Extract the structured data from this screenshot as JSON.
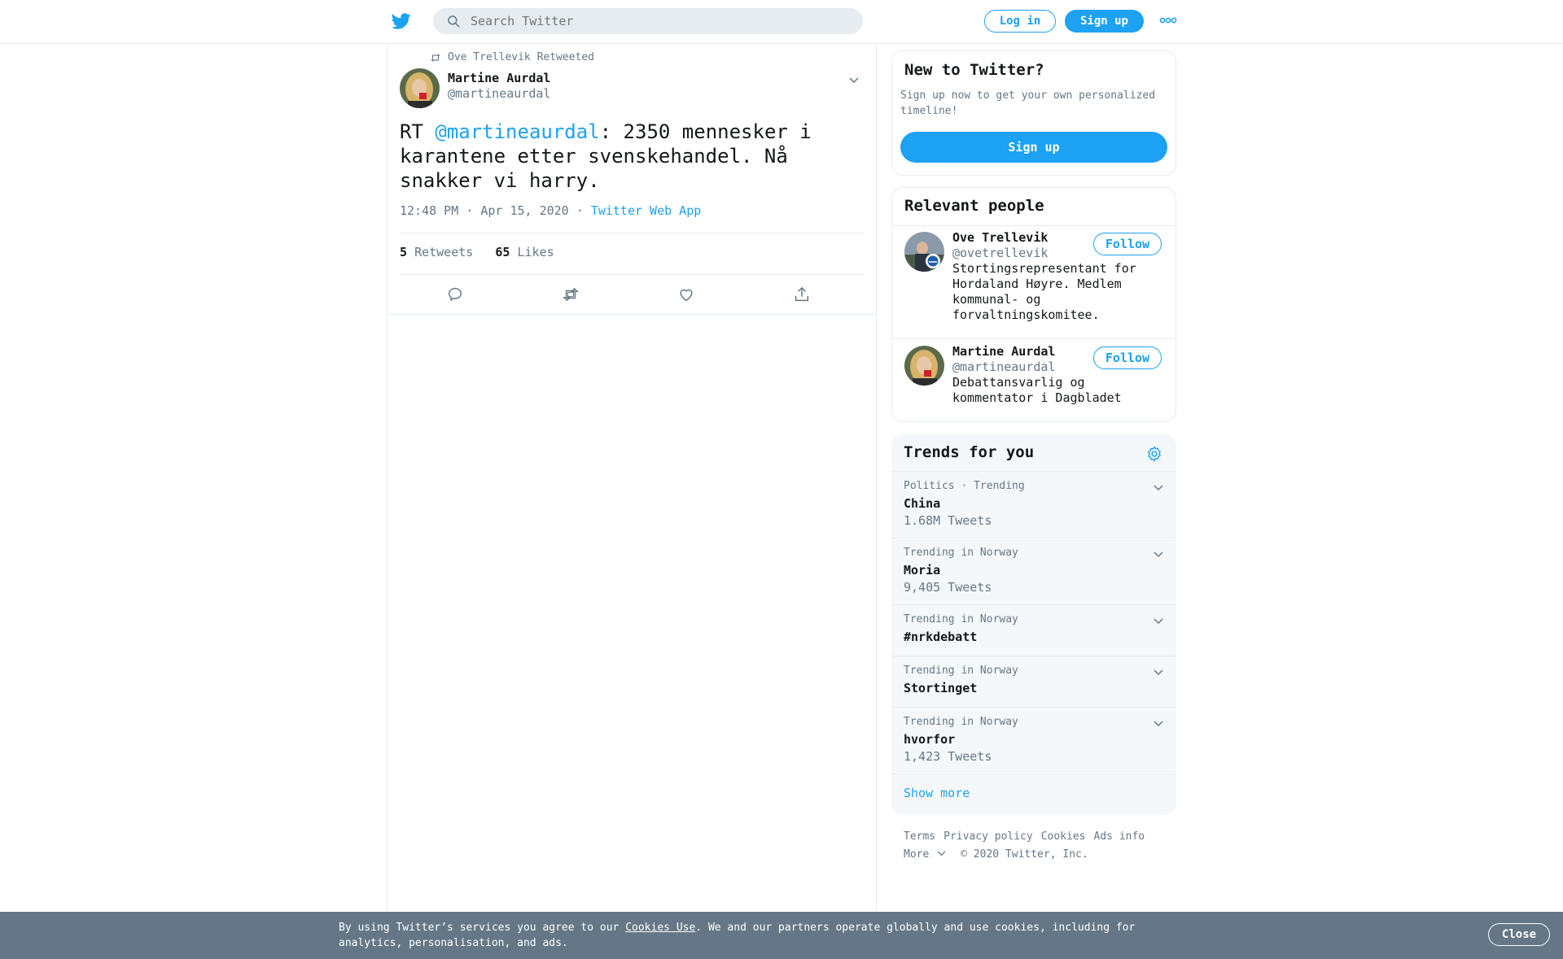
{
  "header": {
    "logo": "twitter-bird-icon",
    "search_placeholder": "Search Twitter",
    "login_label": "Log in",
    "signup_label": "Sign up",
    "more_icon": "more-dots-icon",
    "accent_color": "#1da1f2"
  },
  "tweet": {
    "retweeted_by": "Ove Trellevik Retweeted",
    "author_name": "Martine Aurdal",
    "author_handle": "@martineaurdal",
    "text_prefix": "RT ",
    "mention": "@martineaurdal",
    "text_rest": ": 2350 mennesker i karantene etter svenskehandel. Nå snakker vi harry.",
    "timestamp": "12:48 PM · Apr 15, 2020",
    "separator": "·",
    "source": "Twitter Web App",
    "retweet_count": "5",
    "retweets_label": "Retweets",
    "like_count": "65",
    "likes_label": "Likes",
    "actions": [
      "reply-icon",
      "retweet-icon",
      "like-icon",
      "share-icon"
    ]
  },
  "signup_card": {
    "title": "New to Twitter?",
    "description": "Sign up now to get your own personalized timeline!",
    "button": "Sign up"
  },
  "relevant_people": {
    "title": "Relevant people",
    "people": [
      {
        "name": "Ove Trellevik",
        "handle": "@ovetrellevik",
        "bio": "Stortingsrepresentant for Hordaland Høyre. Medlem kommunal- og forvaltningskomitee.",
        "follow_label": "Follow"
      },
      {
        "name": "Martine Aurdal",
        "handle": "@martineaurdal",
        "bio": "Debattansvarlig og kommentator i Dagbladet",
        "follow_label": "Follow"
      }
    ]
  },
  "trends": {
    "title": "Trends for you",
    "items": [
      {
        "context": "Politics · Trending",
        "name": "China",
        "count": "1.68M Tweets"
      },
      {
        "context": "Trending in Norway",
        "name": "Moria",
        "count": "9,405 Tweets"
      },
      {
        "context": "Trending in Norway",
        "name": "#nrkdebatt",
        "count": ""
      },
      {
        "context": "Trending in Norway",
        "name": "Stortinget",
        "count": ""
      },
      {
        "context": "Trending in Norway",
        "name": "hvorfor",
        "count": "1,423 Tweets"
      }
    ],
    "show_more": "Show more"
  },
  "footer": {
    "links": [
      "Terms",
      "Privacy policy",
      "Cookies",
      "Ads info"
    ],
    "more_label": "More",
    "copyright": "© 2020 Twitter, Inc."
  },
  "cookie_bar": {
    "text_before": "By using Twitter’s services you agree to our ",
    "link": "Cookies Use",
    "text_after": ". We and our partners operate globally and use cookies, including for analytics, personalisation, and ads.",
    "close_label": "Close"
  }
}
